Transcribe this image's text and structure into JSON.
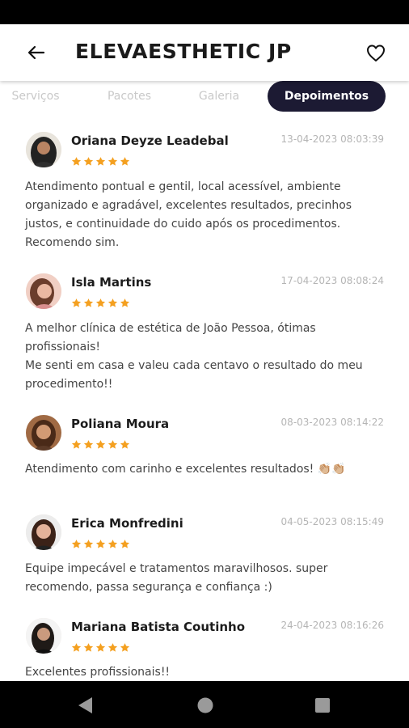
{
  "header": {
    "title": "ELEVAESTHETIC JP",
    "back_icon": "arrow-left-icon",
    "favorite_icon": "heart-outline-icon"
  },
  "tabs": [
    {
      "label": "Serviços",
      "active": false
    },
    {
      "label": "Pacotes",
      "active": false
    },
    {
      "label": "Galeria",
      "active": false
    },
    {
      "label": "Depoimentos",
      "active": true
    }
  ],
  "reviews": [
    {
      "name": "Oriana Deyze Leadebal",
      "date": "13-04-2023 08:03:39",
      "rating": 5,
      "text": "Atendimento pontual e gentil, local acessível, ambiente organizado e agradável, excelentes resultados, precinhos justos, e continuidade do cuido após os procedimentos. Recomendo sim."
    },
    {
      "name": "Isla Martins",
      "date": "17-04-2023 08:08:24",
      "rating": 5,
      "text": "A melhor clínica de estética de João Pessoa, ótimas profissionais!\nMe senti em casa e valeu cada centavo o resultado do meu procedimento!!"
    },
    {
      "name": "Poliana Moura",
      "date": "08-03-2023 08:14:22",
      "rating": 5,
      "text": "Atendimento com carinho e excelentes resultados! 👏🏼👏🏼"
    },
    {
      "name": "Erica Monfredini",
      "date": "04-05-2023 08:15:49",
      "rating": 5,
      "text": "Equipe impecável e tratamentos maravilhosos. super recomendo, passa segurança e confiança :)"
    },
    {
      "name": "Mariana Batista Coutinho",
      "date": "24-04-2023 08:16:26",
      "rating": 5,
      "text": "Excelentes profissionais!!"
    }
  ],
  "colors": {
    "active_tab_bg": "#1c1a33",
    "star": "#f4a020",
    "system_bars": "#000000"
  },
  "nav": {
    "back_icon": "triangle-back-icon",
    "home_icon": "circle-home-icon",
    "recents_icon": "square-recents-icon"
  }
}
